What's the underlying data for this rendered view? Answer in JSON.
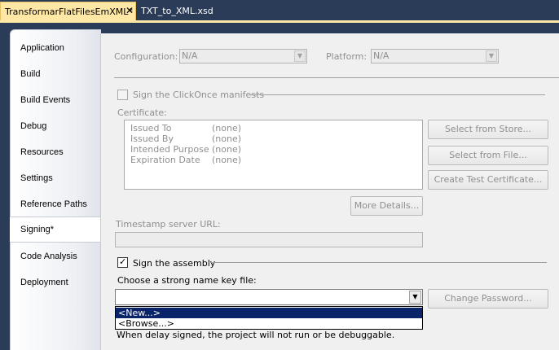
{
  "tabs": [
    {
      "label": "TransformarFlatFilesEmXML*",
      "active": true
    },
    {
      "label": "TXT_to_XML.xsd",
      "active": false
    }
  ],
  "sidebar": {
    "items": [
      {
        "label": "Application"
      },
      {
        "label": "Build"
      },
      {
        "label": "Build Events"
      },
      {
        "label": "Debug"
      },
      {
        "label": "Resources"
      },
      {
        "label": "Settings"
      },
      {
        "label": "Reference Paths"
      },
      {
        "label": "Signing*"
      },
      {
        "label": "Code Analysis"
      },
      {
        "label": "Deployment"
      }
    ],
    "selected_index": 7
  },
  "config": {
    "configuration_label": "Configuration:",
    "configuration_value": "N/A",
    "platform_label": "Platform:",
    "platform_value": "N/A"
  },
  "clickonce": {
    "checkbox_label": "Sign the ClickOnce manifests",
    "checked": false,
    "certificate_label": "Certificate:",
    "fields": [
      {
        "name": "Issued To",
        "value": "(none)"
      },
      {
        "name": "Issued By",
        "value": "(none)"
      },
      {
        "name": "Intended Purpose",
        "value": "(none)"
      },
      {
        "name": "Expiration Date",
        "value": "(none)"
      }
    ],
    "select_store_label": "Select from Store...",
    "select_file_label": "Select from File...",
    "create_test_label": "Create Test Certificate...",
    "more_details_label": "More Details...",
    "timestamp_label": "Timestamp server URL:",
    "timestamp_value": ""
  },
  "assembly": {
    "checkbox_label": "Sign the assembly",
    "checked": true,
    "key_file_label": "Choose a strong name key file:",
    "key_file_value": "",
    "change_password_label": "Change Password...",
    "dropdown_options": [
      "<New...>",
      "<Browse...>"
    ],
    "highlighted_option": 0,
    "delay_note": "When delay signed, the project will not run or be debuggable."
  },
  "colors": {
    "accent_tab": "#ffe8a6",
    "frame": "#2b3c59",
    "highlight": "#0a246a"
  }
}
